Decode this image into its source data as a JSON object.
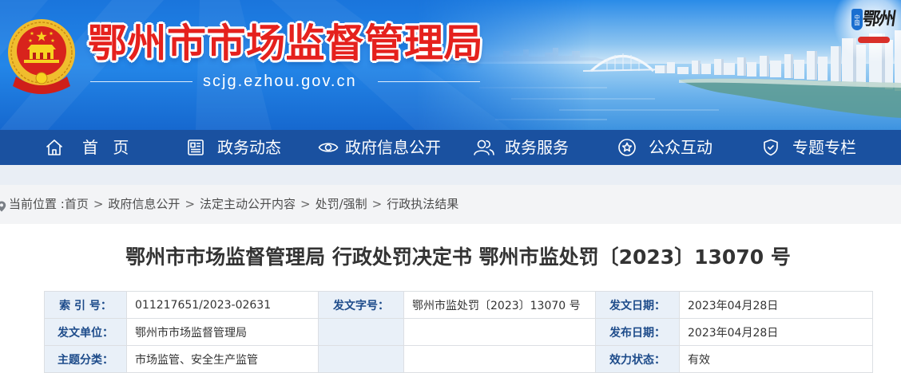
{
  "site": {
    "title": "鄂州市市场监督管理局",
    "url": "scjg.ezhou.gov.cn",
    "logo": {
      "badge": "中国",
      "text": "鄂州"
    }
  },
  "nav": {
    "items": [
      {
        "label": "首 页",
        "icon": "home-icon"
      },
      {
        "label": "政务动态",
        "icon": "news-icon"
      },
      {
        "label": "政府信息公开",
        "icon": "eye-icon"
      },
      {
        "label": "政务服务",
        "icon": "users-icon"
      },
      {
        "label": "公众互动",
        "icon": "star-icon"
      },
      {
        "label": "专题专栏",
        "icon": "shield-icon"
      }
    ]
  },
  "breadcrumb": {
    "prefix": "当前位置 :",
    "separator": ">",
    "items": [
      "首页",
      "政府信息公开",
      "法定主动公开内容",
      "处罚/强制",
      "行政执法结果"
    ]
  },
  "article": {
    "title": "鄂州市市场监督管理局 行政处罚决定书 鄂州市监处罚〔2023〕13070 号"
  },
  "meta_table": {
    "rows": [
      [
        {
          "label": "索 引 号：",
          "value": "011217651/2023-02631"
        },
        {
          "label": "发文字号：",
          "value": "鄂州市监处罚〔2023〕13070 号"
        },
        {
          "label": "发文日期：",
          "value": "2023年04月28日"
        }
      ],
      [
        {
          "label": "发文单位：",
          "value": "鄂州市市场监督管理局"
        },
        {
          "label": "",
          "value": ""
        },
        {
          "label": "发布日期：",
          "value": "2023年04月28日"
        }
      ],
      [
        {
          "label": "主题分类：",
          "value": "市场监管、安全生产监管"
        },
        {
          "label": "",
          "value": ""
        },
        {
          "label": "效力状态：",
          "value": "有效"
        }
      ]
    ]
  },
  "colors": {
    "nav_blue": "#1a51a0",
    "title_red": "#e5211d",
    "label_text": "#1d4b8a",
    "label_bg": "#e9f0f8"
  }
}
